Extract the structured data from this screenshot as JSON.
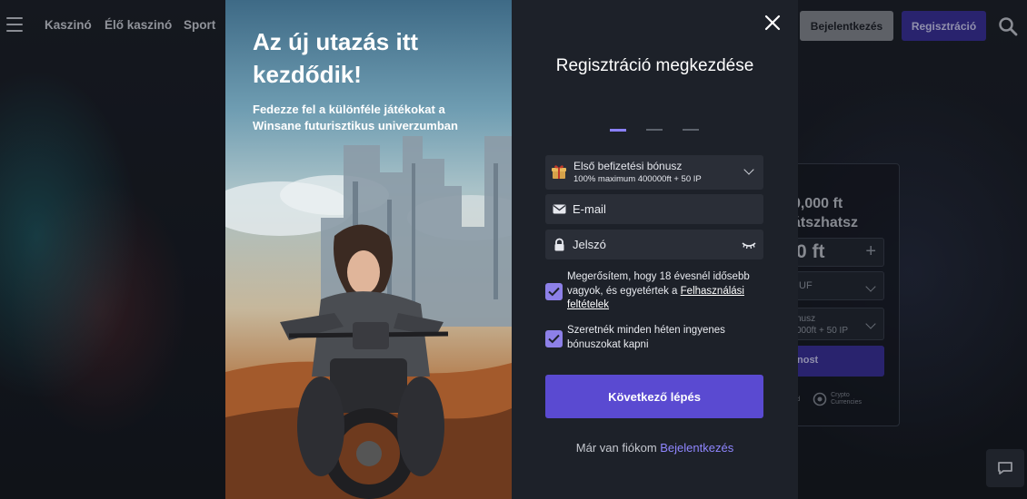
{
  "nav": {
    "items": [
      "Kaszinó",
      "Élő kaszinó",
      "Sport"
    ],
    "login_label": "Bejelentkezés",
    "register_label": "Regisztráció"
  },
  "backdrop": {
    "promo_lines": [
      "0,000 ft",
      "átszhatsz"
    ],
    "amount": "0 ft",
    "plus": "+",
    "currency": "IUF",
    "bonus_line1": "nusz",
    "bonus_line2": "000ft + 50 IP",
    "button": "nost",
    "logos": [
      "ard",
      "Crypto Currencies"
    ]
  },
  "hero": {
    "title": "Az új utazás itt kezdődik!",
    "subtitle": "Fedezze fel a különféle játékokat a Winsane futurisztikus univerzumban"
  },
  "form": {
    "title": "Regisztráció megkezdése",
    "steps": [
      true,
      false,
      false
    ],
    "bonus": {
      "label": "Első befizetési bónusz",
      "detail": "100% maximum 400000ft + 50 IP"
    },
    "email_placeholder": "E-mail",
    "password_placeholder": "Jelszó",
    "terms_text": "Megerősítem, hogy 18 évesnél idősebb vagyok, és egyetértek a ",
    "terms_link": "Felhasználási feltételek",
    "terms_checked": true,
    "newsletter_text": "Szeretnék minden héten ingyenes bónuszokat kapni",
    "newsletter_checked": true,
    "next_label": "Következő lépés",
    "already_text": "Már van fiókom ",
    "already_link": "Bejelentkezés"
  },
  "colors": {
    "accent": "#5a4ad1",
    "checkbox": "#8d80e8",
    "link": "#8f86ff",
    "panel": "#1d2129",
    "field": "#2a2e37"
  }
}
